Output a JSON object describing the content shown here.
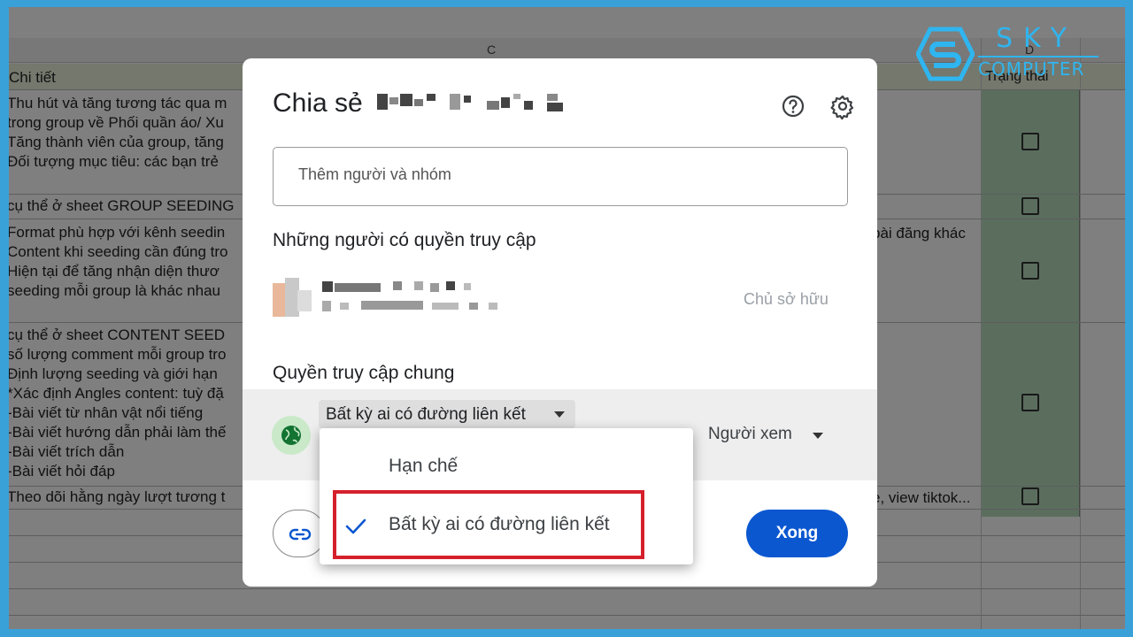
{
  "spreadsheet": {
    "col_c": "C",
    "col_d": "D",
    "header_detail": "Chi tiết",
    "header_status": "Trạng thái",
    "rows": [
      "Thu hút và tăng tương tác qua m",
      "trong group về Phối quần áo/ Xu",
      "Tăng thành viên của group, tăng",
      "Đối tượng mục tiêu: các bạn trẻ",
      "cụ thể ở sheet GROUP SEEDING",
      "Format phù hợp với kênh seedin",
      "Content khi seeding cần đúng tro",
      "Hiện tại để tăng nhận diện thươ",
      "seeding mỗi group là khác nhau",
      "cụ thể ở sheet CONTENT SEED",
      "số lượng comment mỗi group tro",
      "Định lượng seeding và giới hạn",
      "*Xác định Angles content: tuỳ đặ",
      "-Bài viết từ nhân vật nổi tiếng",
      "-Bài viết hướng dẫn phải làm thế",
      "-Bài viết trích dẫn",
      "-Bài viết hỏi đáp",
      "Theo dõi hằng ngày lượt tương t"
    ],
    "right_cell_1": "bài đăng khác",
    "right_cell_2": "e, view tiktok..."
  },
  "logo": {
    "line1": "SKY",
    "line2": "COMPUTER"
  },
  "dialog": {
    "title": "Chia sẻ",
    "help_icon": "help-icon",
    "settings_icon": "settings-gear-icon",
    "add_people_placeholder": "Thêm người và nhóm",
    "people_with_access_heading": "Những người có quyền truy cập",
    "owner_label": "Chủ sở hữu",
    "general_access_heading": "Quyền truy cập chung",
    "general_access_value": "Bất kỳ ai có đường liên kết",
    "role_value": "Người xem",
    "done_button": "Xong",
    "copy_link_icon": "link-icon"
  },
  "dropdown": {
    "options": [
      {
        "label": "Hạn chế",
        "selected": false
      },
      {
        "label": "Bất kỳ ai có đường liên kết",
        "selected": true
      }
    ]
  },
  "colors": {
    "frame": "#3aa0d8",
    "done_button": "#0b57d0",
    "highlight_box": "#d5202c",
    "status_column": "#b7dcbc"
  }
}
